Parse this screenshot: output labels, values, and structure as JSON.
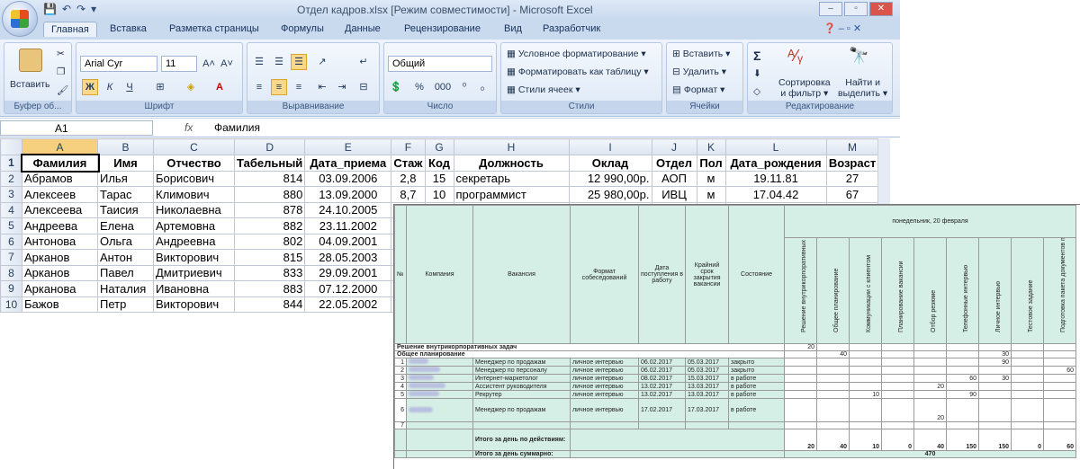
{
  "window": {
    "title": "Отдел кадров.xlsx  [Режим совместимости] - Microsoft Excel",
    "controls": [
      "–",
      "▫",
      "✕"
    ]
  },
  "tabs": [
    "Главная",
    "Вставка",
    "Разметка страницы",
    "Формулы",
    "Данные",
    "Рецензирование",
    "Вид",
    "Разработчик"
  ],
  "ribbon": {
    "clipboard": {
      "paste": "Вставить",
      "label": "Буфер об..."
    },
    "font": {
      "name": "Arial Cyr",
      "size": "11",
      "label": "Шрифт",
      "bold": "Ж",
      "italic": "К",
      "underline": "Ч"
    },
    "alignment": {
      "label": "Выравнивание"
    },
    "number": {
      "format": "Общий",
      "percent": "%",
      "thousands": "000",
      "label": "Число"
    },
    "styles": {
      "cond": "Условное форматирование",
      "table": "Форматировать как таблицу",
      "cell": "Стили ячеек",
      "label": "Стили"
    },
    "cells": {
      "insert": "Вставить",
      "delete": "Удалить",
      "format": "Формат",
      "label": "Ячейки"
    },
    "editing": {
      "sum": "Σ",
      "sort": "Сортировка\nи фильтр",
      "sort1": "Сортировка",
      "sort2": "и фильтр",
      "find1": "Найти и",
      "find2": "выделить",
      "label": "Редактирование"
    }
  },
  "formula_bar": {
    "cell": "A1",
    "fx": "fx",
    "value": "Фамилия"
  },
  "sheet": {
    "columns": [
      "A",
      "B",
      "C",
      "D",
      "E",
      "F",
      "G",
      "H",
      "I",
      "J",
      "K",
      "L",
      "M"
    ],
    "header": [
      "Фамилия",
      "Имя",
      "Отчество",
      "Табельный",
      "Дата_приема",
      "Стаж",
      "Код",
      "Должность",
      "Оклад",
      "Отдел",
      "Пол",
      "Дата_рождения",
      "Возраст"
    ],
    "rows": [
      [
        "Абрамов",
        "Илья",
        "Борисович",
        "814",
        "03.09.2006",
        "2,8",
        "15",
        "секретарь",
        "12 990,00р.",
        "АОП",
        "м",
        "19.11.81",
        "27"
      ],
      [
        "Алексеев",
        "Тарас",
        "Климович",
        "880",
        "13.09.2000",
        "8,7",
        "10",
        "программист",
        "25 980,00р.",
        "ИВЦ",
        "м",
        "17.04.42",
        "67"
      ],
      [
        "Алексеева",
        "Таисия",
        "Николаевна",
        "878",
        "24.10.2005"
      ],
      [
        "Андреева",
        "Елена",
        "Артемовна",
        "882",
        "23.11.2002"
      ],
      [
        "Антонова",
        "Ольга",
        "Андреевна",
        "802",
        "04.09.2001"
      ],
      [
        "Арканов",
        "Антон",
        "Викторович",
        "815",
        "28.05.2003"
      ],
      [
        "Арканов",
        "Павел",
        "Дмитриевич",
        "833",
        "29.09.2001"
      ],
      [
        "Арканова",
        "Наталия",
        "Ивановна",
        "883",
        "07.12.2000"
      ],
      [
        "Бажов",
        "Петр",
        "Викторович",
        "844",
        "22.05.2002"
      ]
    ]
  },
  "overlay": {
    "headers": {
      "num": "№",
      "company": "Компания",
      "vacancy": "Вакансия",
      "format": "Формат собеседований",
      "date_in": "Дата поступления в работу",
      "deadline": "Крайний срок закрытия вакансии",
      "state": "Состояние",
      "day": "понедельник, 20 февраля"
    },
    "activities": [
      "Решение внутрикорпоративных задач",
      "Общее планирование",
      "Коммуникации с клиентом",
      "Планирование вакансии",
      "Отбор резюме",
      "Телефонные интервью",
      "Личное интервью",
      "Тестовое задание",
      "Подготовка пакета документов по финалистам"
    ],
    "section1": "Решение внутрикорпоративных задач",
    "section1_val": "20",
    "section2": "Общее  планирование",
    "section2_vals": [
      "",
      "40",
      "",
      "",
      "",
      "",
      "30",
      "",
      ""
    ],
    "rows": [
      {
        "n": "1",
        "vacancy": "Менеджер по продажам",
        "format": "личное интервью",
        "in": "06.02.2017",
        "dl": "05.03.2017",
        "state": "закрыто",
        "vals": [
          "",
          "",
          "",
          "",
          "",
          "",
          "90",
          "",
          ""
        ]
      },
      {
        "n": "2",
        "vacancy": "Менеджер по персоналу",
        "format": "личное интервью",
        "in": "06.02.2017",
        "dl": "05.03.2017",
        "state": "закрыто",
        "vals": [
          "",
          "",
          "",
          "",
          "",
          "",
          "",
          "",
          "60"
        ]
      },
      {
        "n": "3",
        "vacancy": "Интернет-маркетолог",
        "format": "личное интервью",
        "in": "08.02.2017",
        "dl": "15.03.2017",
        "state": "в работе",
        "vals": [
          "",
          "",
          "",
          "",
          "",
          "60",
          "30",
          "",
          ""
        ]
      },
      {
        "n": "4",
        "vacancy": "Ассистент руководителя",
        "format": "личное интервью",
        "in": "13.02.2017",
        "dl": "13.03.2017",
        "state": "в работе",
        "vals": [
          "",
          "",
          "",
          "",
          "20",
          "",
          "",
          "",
          ""
        ]
      },
      {
        "n": "5",
        "vacancy": "Рекрутер",
        "format": "личное интервью",
        "in": "13.02.2017",
        "dl": "13.03.2017",
        "state": "в работе",
        "vals": [
          "",
          "",
          "10",
          "",
          "",
          "90",
          "",
          "",
          ""
        ]
      },
      {
        "n": "6",
        "vacancy": "Менеджер по продажам",
        "format": "личное интервью",
        "in": "17.02.2017",
        "dl": "17.03.2017",
        "state": "в работе",
        "vals": [
          "",
          "",
          "",
          "",
          "20",
          "",
          "",
          "",
          ""
        ]
      },
      {
        "n": "7",
        "vacancy": "",
        "format": "",
        "in": "",
        "dl": "",
        "state": "",
        "vals": [
          "",
          "",
          "",
          "",
          "",
          "",
          "",
          "",
          ""
        ]
      }
    ],
    "total_label": "Итого за день по действиям:",
    "totals": [
      "20",
      "40",
      "10",
      "0",
      "40",
      "150",
      "150",
      "0",
      "60"
    ],
    "sum_label": "Итого за день суммарно:",
    "sum": "470"
  }
}
